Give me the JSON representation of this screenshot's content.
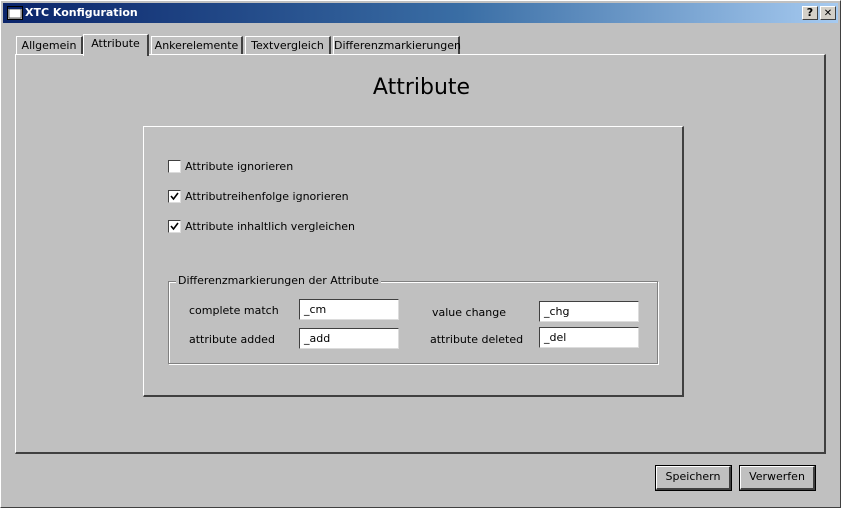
{
  "window": {
    "title": "XTC Konfiguration",
    "help_glyph": "?",
    "close_glyph": "✕"
  },
  "tabs": [
    {
      "label": "Allgemein",
      "active": false
    },
    {
      "label": "Attribute",
      "active": true
    },
    {
      "label": "Ankerelemente",
      "active": false
    },
    {
      "label": "Textvergleich",
      "active": false
    },
    {
      "label": "Differenzmarkierungen",
      "active": false
    }
  ],
  "page": {
    "title": "Attribute"
  },
  "options": [
    {
      "label": "Attribute ignorieren",
      "checked": false
    },
    {
      "label": "Attributreihenfolge ignorieren",
      "checked": true
    },
    {
      "label": "Attribute inhaltlich vergleichen",
      "checked": true
    }
  ],
  "markers": {
    "legend": "Differenzmarkierungen der Attribute",
    "complete_match": {
      "label": "complete match",
      "value": "_cm"
    },
    "value_change": {
      "label": "value change",
      "value": "_chg"
    },
    "attribute_added": {
      "label": "attribute added",
      "value": "_add"
    },
    "attribute_deleted": {
      "label": "attribute deleted",
      "value": "_del"
    }
  },
  "buttons": {
    "save": "Speichern",
    "discard": "Verwerfen"
  }
}
